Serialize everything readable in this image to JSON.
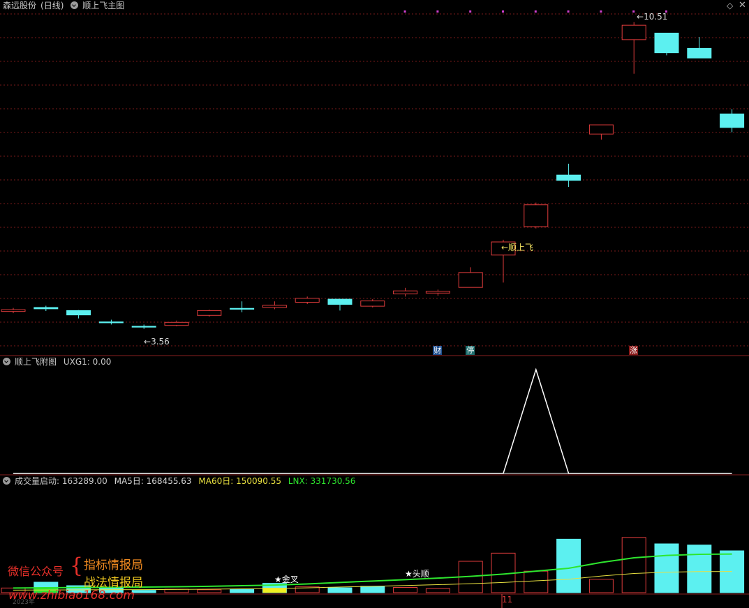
{
  "header": {
    "stock_name": "森远股份",
    "period": "(日线)",
    "main_indicator": "顺上飞主图"
  },
  "main_chart": {
    "high_label": "10.51",
    "low_label": "3.56",
    "signal_label": "←顺上飞",
    "badges": [
      {
        "text": "财",
        "bar": 13,
        "color": "#1f4f8f"
      },
      {
        "text": "停",
        "bar": 14,
        "color": "#1f6f6f"
      },
      {
        "text": "涨",
        "bar": 19,
        "color": "#8b1a1a"
      }
    ],
    "dots": [
      12,
      13,
      14,
      15,
      16,
      17,
      18,
      19,
      20
    ],
    "price_range": [
      3.3,
      10.8
    ],
    "candles": [
      {
        "o": 3.96,
        "c": 4.0,
        "h": 4.04,
        "l": 3.92
      },
      {
        "o": 4.05,
        "c": 4.02,
        "h": 4.09,
        "l": 3.97
      },
      {
        "o": 3.98,
        "c": 3.88,
        "h": 3.99,
        "l": 3.8
      },
      {
        "o": 3.72,
        "c": 3.7,
        "h": 3.77,
        "l": 3.66
      },
      {
        "o": 3.62,
        "c": 3.6,
        "h": 3.66,
        "l": 3.56
      },
      {
        "o": 3.64,
        "c": 3.71,
        "h": 3.75,
        "l": 3.62
      },
      {
        "o": 3.87,
        "c": 3.98,
        "h": 4.0,
        "l": 3.84
      },
      {
        "o": 4.03,
        "c": 4.01,
        "h": 4.19,
        "l": 3.94
      },
      {
        "o": 4.05,
        "c": 4.1,
        "h": 4.19,
        "l": 4.01
      },
      {
        "o": 4.17,
        "c": 4.26,
        "h": 4.3,
        "l": 4.13
      },
      {
        "o": 4.24,
        "c": 4.12,
        "h": 4.25,
        "l": 3.98
      },
      {
        "o": 4.08,
        "c": 4.2,
        "h": 4.24,
        "l": 4.05
      },
      {
        "o": 4.36,
        "c": 4.43,
        "h": 4.5,
        "l": 4.3
      },
      {
        "o": 4.38,
        "c": 4.42,
        "h": 4.46,
        "l": 4.32
      },
      {
        "o": 4.51,
        "c": 4.85,
        "h": 4.97,
        "l": 4.51
      },
      {
        "o": 5.25,
        "c": 5.55,
        "h": 5.6,
        "l": 4.62
      },
      {
        "o": 5.9,
        "c": 6.4,
        "h": 6.45,
        "l": 5.86
      },
      {
        "o": 7.08,
        "c": 6.96,
        "h": 7.34,
        "l": 6.81
      },
      {
        "o": 8.02,
        "c": 8.23,
        "h": 8.23,
        "l": 7.89
      },
      {
        "o": 10.18,
        "c": 10.51,
        "h": 10.58,
        "l": 9.4
      },
      {
        "o": 10.33,
        "c": 9.88,
        "h": 10.33,
        "l": 9.82
      },
      {
        "o": 9.98,
        "c": 9.76,
        "h": 10.24,
        "l": 9.76
      },
      {
        "o": 8.48,
        "c": 8.17,
        "h": 8.59,
        "l": 8.06
      }
    ]
  },
  "sub_chart": {
    "title": "顺上飞附图",
    "uxg1_label": "UXG1: 0.00",
    "uxg1": [
      0,
      0,
      0,
      0,
      0,
      0,
      0,
      0,
      0,
      0,
      0,
      0,
      0,
      0,
      0,
      0,
      1,
      0,
      0,
      0,
      0,
      0,
      0
    ],
    "ylim": [
      0,
      1
    ]
  },
  "volume_chart": {
    "title": "成交量启动",
    "value_label": ": 163289.00",
    "ma5_label": "MA5日: 168455.63",
    "ma60_label": "MA60日: 150090.55",
    "lnx_label": "LNX: 331730.56",
    "signal_jincha": "★金叉",
    "signal_toushun": "★头顺",
    "axis_label": "11",
    "date_label": "2023年",
    "volume_top": 900000,
    "volumes": [
      {
        "v": 40000,
        "up": true
      },
      {
        "v": 90000,
        "up": false
      },
      {
        "v": 60000,
        "up": false
      },
      {
        "v": 40000,
        "up": false
      },
      {
        "v": 20000,
        "up": false
      },
      {
        "v": 30000,
        "up": true
      },
      {
        "v": 25000,
        "up": true
      },
      {
        "v": 28000,
        "up": false
      },
      {
        "v": 80000,
        "up": false
      },
      {
        "v": 50000,
        "up": true
      },
      {
        "v": 42000,
        "up": false
      },
      {
        "v": 55000,
        "up": false
      },
      {
        "v": 45000,
        "up": true
      },
      {
        "v": 35000,
        "up": true
      },
      {
        "v": 270000,
        "up": true
      },
      {
        "v": 340000,
        "up": true
      },
      {
        "v": 185000,
        "up": true
      },
      {
        "v": 460000,
        "up": false
      },
      {
        "v": 115000,
        "up": true
      },
      {
        "v": 475000,
        "up": true
      },
      {
        "v": 420000,
        "up": false
      },
      {
        "v": 410000,
        "up": false
      },
      {
        "v": 360000,
        "up": false
      }
    ],
    "ma60": [
      40000,
      42000,
      44000,
      46000,
      48000,
      51000,
      55000,
      60000,
      65000,
      75000,
      88000,
      100000,
      112000,
      125000,
      140000,
      160000,
      185000,
      210000,
      260000,
      300000,
      320000,
      330000,
      332000
    ]
  },
  "watermark": {
    "wechat_label": "微信公众号",
    "line1": "指标情报局",
    "line2": "战法情报局",
    "url": "www.zhibiao168.com"
  },
  "colors": {
    "up": "#e03c3c",
    "down": "#5cf0f0",
    "divider": "#8a1f1f",
    "grid": "#7a1a1a",
    "uxg": "#ffffff",
    "ma60": "#e8e040",
    "lnx": "#2ee62e",
    "dot": "#d040d0"
  }
}
